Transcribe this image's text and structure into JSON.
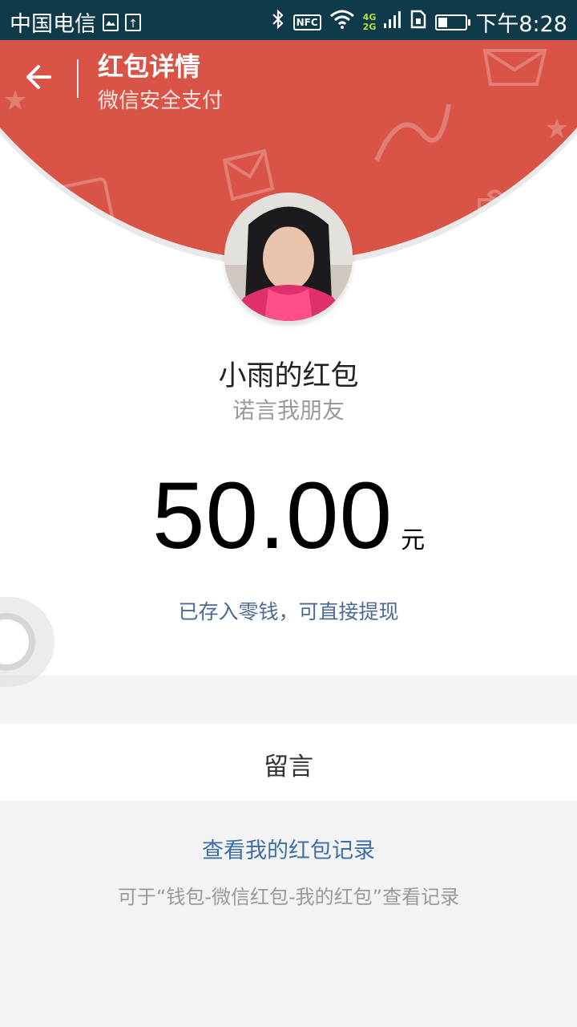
{
  "status_bar": {
    "carrier": "中国电信",
    "network_labels": [
      "4G",
      "2G"
    ],
    "nfc_label": "NFC",
    "time": "下午8:28",
    "battery_level": 0.35,
    "icons": [
      "image-icon",
      "upload-icon",
      "bluetooth-icon",
      "nfc-icon",
      "wifi-icon",
      "signal-icon",
      "sim-icon",
      "battery-icon"
    ]
  },
  "header": {
    "title": "红包详情",
    "subtitle": "微信安全支付",
    "back_icon": "back-arrow-icon",
    "color": "#d95447"
  },
  "packet": {
    "sender": "小雨的红包",
    "greeting": "诺言我朋友",
    "amount": "50.00",
    "unit": "元",
    "deposit_note": "已存入零钱，可直接提现"
  },
  "message": {
    "label": "留言"
  },
  "records": {
    "link": "查看我的红包记录",
    "hint": "可于“钱包-微信红包-我的红包”查看记录"
  },
  "colors": {
    "status_bar": "#0f3a4a",
    "accent_red": "#d95447",
    "link_blue": "#3c6fa6",
    "note_blue": "#4b6a94"
  }
}
